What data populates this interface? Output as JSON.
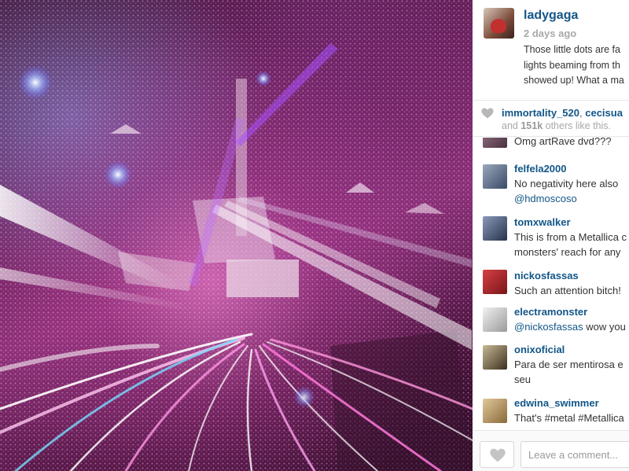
{
  "post": {
    "username": "ladygaga",
    "time_ago": "2 days ago",
    "caption_lines": [
      "Those little dots are fa",
      "lights beaming from th",
      "showed up! What a ma"
    ]
  },
  "likes": {
    "user1": "immortality_520",
    "separator": ", ",
    "user2": "cecisua",
    "and_text": "and ",
    "count": "151k",
    "others_text": " others like this."
  },
  "comments": [
    {
      "username": "",
      "text": "Omg artRave dvd???",
      "avatar_color": "#6b4a5a"
    },
    {
      "username": "felfela2000",
      "text_lines": [
        "No negativity here also"
      ],
      "mention": "@hdmoscoso",
      "avatar_color": "#4a5f7a"
    },
    {
      "username": "tomxwalker",
      "text_lines": [
        "This is from a Metallica c",
        "monsters' reach for any"
      ],
      "avatar_color": "#3b4a6a"
    },
    {
      "username": "nickosfassas",
      "text_lines": [
        "Such an attention bitch!"
      ],
      "avatar_color": "#b0282c"
    },
    {
      "username": "electramonster",
      "mention": "@nickosfassas",
      "text_after": " wow you",
      "avatar_color": "#cfcfcf"
    },
    {
      "username": "onixoficial",
      "text_lines": [
        "Para de ser mentirosa e",
        "seu"
      ],
      "avatar_color": "#6a5a40"
    },
    {
      "username": "edwina_swimmer",
      "text_lines": [
        "That's #metal #Metallica"
      ],
      "avatar_color": "#a48a5a"
    }
  ],
  "footer": {
    "comment_placeholder": "Leave a comment..."
  },
  "colors": {
    "link": "#125688",
    "muted": "#a9a9a9",
    "text": "#333333"
  }
}
